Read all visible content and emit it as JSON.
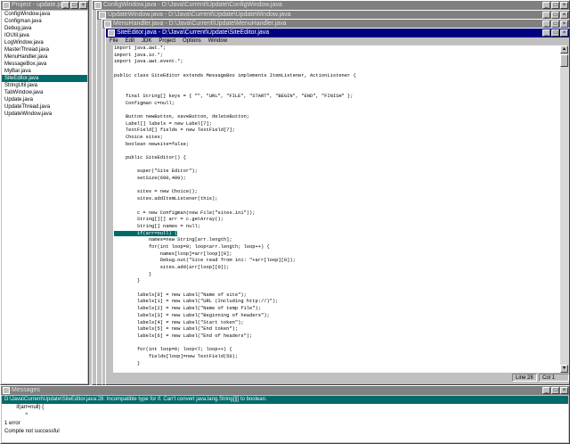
{
  "project": {
    "title": "Project - update.prj",
    "files": [
      "ConfigWindow.java",
      "Configman.java",
      "Debug.java",
      "IOUtil.java",
      "LogWindow.java",
      "MasterThread.java",
      "MenuHandler.java",
      "MessageBox.java",
      "MyBar.java",
      "SiteEditor.java",
      "StringUtil.java",
      "TabWindow.java",
      "Update.java",
      "UpdateThread.java",
      "UpdateWindow.java"
    ],
    "selected_index": 9
  },
  "bg_windows": [
    {
      "title": "ConfigWindow.java - D:\\Java\\Current\\Update\\ConfigWindow.java"
    },
    {
      "title": "UpdateWindow.java - D:\\Java\\Current\\Update\\UpdateWindow.java"
    },
    {
      "title": "MenuHandler.java - D:\\Java\\Current\\Update\\MenuHandler.java"
    }
  ],
  "editor": {
    "title": "SiteEditor.java - D:\\Java\\Current\\Update\\SiteEditor.java",
    "menu": [
      "File",
      "Edit",
      "JDK",
      "Project",
      "Options",
      "Window"
    ],
    "lines": [
      "import java.awt.*;",
      "import java.io.*;",
      "import java.awt.event.*;",
      "",
      "public class SiteEditor extends MessageBox implements ItemListener, ActionListener {",
      "",
      "",
      "    final String[] keys = { \"\", \"URL\", \"FILE\", \"START\", \"BEGIN\", \"END\", \"FINISH\" };",
      "    Configman c=null;",
      "",
      "    Button newButton, saveButton, deleteButton;",
      "    Label[] labels = new Label[7];",
      "    TextField[] fields = new TextField[7];",
      "    Choice sites;",
      "    boolean newsite=false;",
      "",
      "    public SiteEditor() {",
      "",
      "        super(\"Site Editor\");",
      "        setSize(600,400);",
      "",
      "        sites = new Choice();",
      "        sites.addItemListener(this);",
      "",
      "        c = new Configman(new File(\"sites.ini\"));",
      "        String[][] arr = c.getArray();",
      "        String[] names = null;",
      "        if(arr=null) {",
      "            names=new String[arr.length];",
      "            for(int loop=0; loop<arr.length; loop++) {",
      "                names[loop]=arr[loop][0];",
      "                Debug.out(\"Site read from ini: \"+arr[loop][0]);",
      "                sites.add(arr[loop][0]);",
      "            }",
      "        }",
      "",
      "        labels[0] = new Label(\"Name of site\");",
      "        labels[1] = new Label(\"URL (Including http://)\");",
      "        labels[2] = new Label(\"Name of temp file\");",
      "        labels[3] = new Label(\"Beginning of headers\");",
      "        labels[4] = new Label(\"Start token\");",
      "        labels[5] = new Label(\"End token\");",
      "        labels[6] = new Label(\"End of headers\");",
      "",
      "        for(int loop=0; loop<7; loop++) {",
      "            fields[loop]=new TextField(50);",
      "        }"
    ],
    "highlight_line_index": 27,
    "status_line": "Line 28",
    "status_col": "Col 1"
  },
  "messages": {
    "title": "Messages",
    "lines": [
      "D:\\Java\\Current\\Update\\SiteEditor.java:28: Incompatible type for if. Can't convert java.lang.String[][] to boolean.",
      "        if(arr=null) {",
      "              ^",
      "1 error",
      "Compile not successful"
    ],
    "error_index": 0
  },
  "colors": {
    "active_title": "#000080",
    "inactive_title": "#808080",
    "highlight": "#006a6a"
  }
}
